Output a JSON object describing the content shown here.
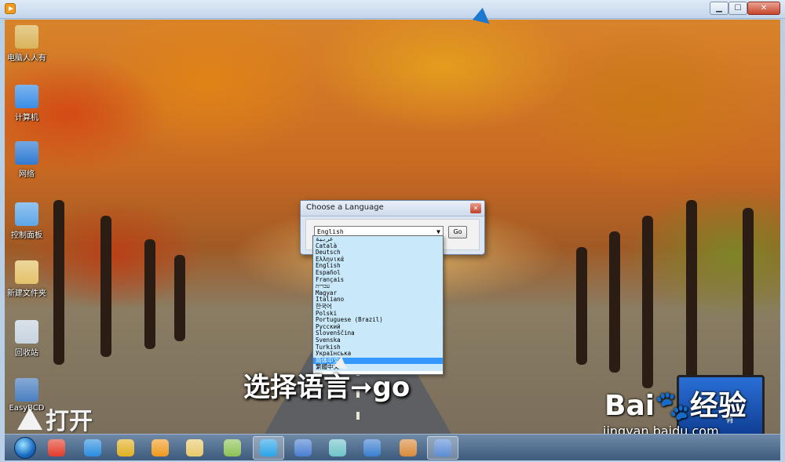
{
  "window": {
    "minimize_label": "▁",
    "maximize_label": "☐",
    "close_label": "✕"
  },
  "desktop_icons": [
    {
      "label": "电脑人人有",
      "icon": "user-folder-icon",
      "color": "#d9b45a"
    },
    {
      "label": "计算机",
      "icon": "computer-icon",
      "color": "#3a8ee6"
    },
    {
      "label": "网络",
      "icon": "network-icon",
      "color": "#2f7bd3"
    },
    {
      "label": "控制面板",
      "icon": "control-panel-icon",
      "color": "#5da7e8"
    },
    {
      "label": "新建文件夹",
      "icon": "folder-icon",
      "color": "#e3c26a"
    },
    {
      "label": "回收站",
      "icon": "recycle-bin-icon",
      "color": "#c7d3df"
    },
    {
      "label": "EasyBCD",
      "icon": "easybcd-icon",
      "color": "#4a7fc1"
    }
  ],
  "dialog": {
    "title": "Choose a Language",
    "close_label": "✕",
    "selected_value": "English",
    "dropdown_arrow": "▼",
    "go_label": "Go"
  },
  "languages": [
    "عربية",
    "Català",
    "Deutsch",
    "Ελληνικά",
    "English",
    "Español",
    "Français",
    "עברית",
    "Magyar",
    "Italiano",
    "한국어",
    "Polski",
    "Portuguese (Brazil)",
    "Русский",
    "Slovenščina",
    "Svenska",
    "Turkish",
    "Українська",
    "简体中文",
    "繁體中文"
  ],
  "highlighted_language_index": 18,
  "overlay": {
    "caption": "选择语言➞go",
    "open_caption": "打开",
    "watermark_brand": "Bai🐾经验",
    "watermark_url": "jingyan.baidu.com",
    "laptop_text": "有"
  },
  "taskbar": {
    "items": [
      {
        "name": "start-button",
        "icon": "windows-orb-icon",
        "color": "#1a6bc2"
      },
      {
        "name": "jiang-app-button",
        "icon": "jiang-app-icon",
        "color": "#e23b2a"
      },
      {
        "name": "ie-button",
        "icon": "internet-explorer-icon",
        "color": "#2a8de0"
      },
      {
        "name": "chrome-button",
        "icon": "chrome-icon",
        "color": "#e0b020"
      },
      {
        "name": "media-player-button",
        "icon": "media-player-icon",
        "color": "#f09a1e"
      },
      {
        "name": "explorer-button",
        "icon": "file-explorer-icon",
        "color": "#e8c96b"
      },
      {
        "name": "folder-app-button",
        "icon": "folder-app-icon",
        "color": "#8cc255"
      },
      {
        "name": "qq-browser-button",
        "icon": "qq-browser-icon",
        "color": "#2aa4e8"
      },
      {
        "name": "word-button",
        "icon": "word-document-icon",
        "color": "#4a7fd1"
      },
      {
        "name": "settings-app-button",
        "icon": "gear-app-icon",
        "color": "#6fc4c9"
      },
      {
        "name": "remote-desktop-button",
        "icon": "remote-desktop-icon",
        "color": "#3b7fd0"
      },
      {
        "name": "paint-button",
        "icon": "paint-icon",
        "color": "#d88a3a"
      },
      {
        "name": "easybcd-task-button",
        "icon": "easybcd-icon",
        "color": "#5b8dd3"
      }
    ]
  }
}
